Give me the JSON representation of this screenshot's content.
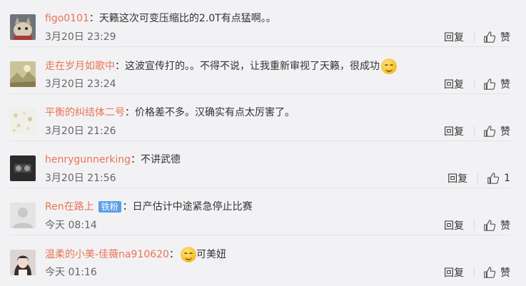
{
  "comments": [
    {
      "username": "figo0101",
      "colon": "：",
      "text": "天籁这次可变压缩比的2.0T有点猛啊。。",
      "time": "3月20日 23:29",
      "reply_label": "回复",
      "like_label": "赞",
      "avatar": "avatar-cat",
      "colors": {
        "bg": "#7a7f86",
        "fg": "#d9cdb8"
      }
    },
    {
      "username": "走在岁月如歌中",
      "colon": "：",
      "text": "这波宣传打的。。不得不说，让我重新审视了天籁，很成功",
      "emoji": "shy-smile-emoji",
      "time": "3月20日 23:24",
      "reply_label": "回复",
      "like_label": "赞",
      "avatar": "avatar-landscape",
      "colors": {
        "bg": "#c9c39a",
        "fg": "#ede7c7"
      }
    },
    {
      "username": "平衡的纠结体二号",
      "colon": "：",
      "text": "价格差不多。汉确实有点太厉害了。",
      "time": "3月20日 21:26",
      "reply_label": "回复",
      "like_label": "赞",
      "avatar": "avatar-dots",
      "colors": {
        "bg": "#f0efe8",
        "fg": "#d8d3b5"
      }
    },
    {
      "username": "henrygunnerking",
      "colon": "：",
      "text": "不讲武德",
      "time": "3月20日 21:56",
      "reply_label": "回复",
      "like_label": "1",
      "avatar": "avatar-dark",
      "colors": {
        "bg": "#2b2b2b",
        "fg": "#9b9b9b"
      }
    },
    {
      "username": "Ren在路上",
      "badge": "铁粉",
      "colon": "：",
      "text": "日产估计中途紧急停止比赛",
      "time": "今天 08:14",
      "reply_label": "回复",
      "like_label": "赞",
      "avatar": "avatar-default",
      "colors": {
        "bg": "#e4e4e4",
        "fg": "#c8c8c8"
      }
    },
    {
      "username": "温柔的小美-佳薇na910620",
      "colon": "：",
      "emoji": "smile-emoji",
      "text": "可美妞",
      "time": "今天 01:16",
      "reply_label": "回复",
      "like_label": "赞",
      "avatar": "avatar-girl",
      "colors": {
        "bg": "#dcd6d2",
        "fg": "#3a2f2c"
      }
    }
  ],
  "colors": {
    "username": "#eb7350",
    "badge": "#5aa0e6",
    "background": "#f2f2f5",
    "divider": "#e3e3e6"
  },
  "icons": {
    "like": "thumbs-up-icon"
  }
}
